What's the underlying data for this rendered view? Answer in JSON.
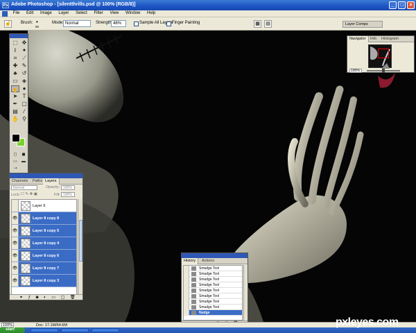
{
  "titlebar": {
    "title": "Adobe Photoshop - [silentthrills.psd @ 100% (RGB/8)]",
    "minimize": "_",
    "maximize": "□",
    "close": "×"
  },
  "menubar": {
    "items": [
      "File",
      "Edit",
      "Image",
      "Layer",
      "Select",
      "Filter",
      "View",
      "Window",
      "Help"
    ]
  },
  "options_bar": {
    "brush_label": "Brush:",
    "brush_size": "65",
    "mode_label": "Mode:",
    "mode_value": "Normal",
    "strength_label": "Strength:",
    "strength_value": "46%",
    "sample_all_layers": "Sample All Layers",
    "finger_painting": "Finger Painting",
    "layer_comps_tab": "Layer Comps"
  },
  "colors": {
    "foreground": "#000000",
    "background": "#7bd12c"
  },
  "navigator": {
    "tabs": [
      "Navigator",
      "Info",
      "Histogram"
    ],
    "zoom": "100%"
  },
  "layers_panel": {
    "tabs": [
      "Channels",
      "Paths",
      "Layers"
    ],
    "blend_mode": "Normal",
    "opacity_label": "Opacity:",
    "opacity_value": "100%",
    "lock_label": "Lock:",
    "fill_label": "Fill:",
    "fill_value": "100%",
    "layers": [
      {
        "name": "Layer 9",
        "selected": false
      },
      {
        "name": "Layer 8 copy 8",
        "selected": true
      },
      {
        "name": "Layer 8 copy 5",
        "selected": true
      },
      {
        "name": "Layer 8 copy 4",
        "selected": true
      },
      {
        "name": "Layer 8 copy 6",
        "selected": true
      },
      {
        "name": "Layer 8 copy 7",
        "selected": true
      },
      {
        "name": "Layer 8 copy 3",
        "selected": true
      }
    ]
  },
  "history_panel": {
    "tabs": [
      "History",
      "Actions"
    ],
    "steps": [
      {
        "name": "Smudge Tool",
        "selected": false
      },
      {
        "name": "Smudge Tool",
        "selected": false
      },
      {
        "name": "Smudge Tool",
        "selected": false
      },
      {
        "name": "Smudge Tool",
        "selected": false
      },
      {
        "name": "Smudge Tool",
        "selected": false
      },
      {
        "name": "Smudge Tool",
        "selected": false
      },
      {
        "name": "Smudge Tool",
        "selected": false
      },
      {
        "name": "Smudge Tool",
        "selected": false
      },
      {
        "name": "Nudge",
        "selected": true
      }
    ]
  },
  "status_bar": {
    "zoom": "100%",
    "doc_info": "Doc: 17.1M/64.6M"
  },
  "taskbar": {
    "start_label": "start"
  },
  "watermark": "pxleyes.com"
}
